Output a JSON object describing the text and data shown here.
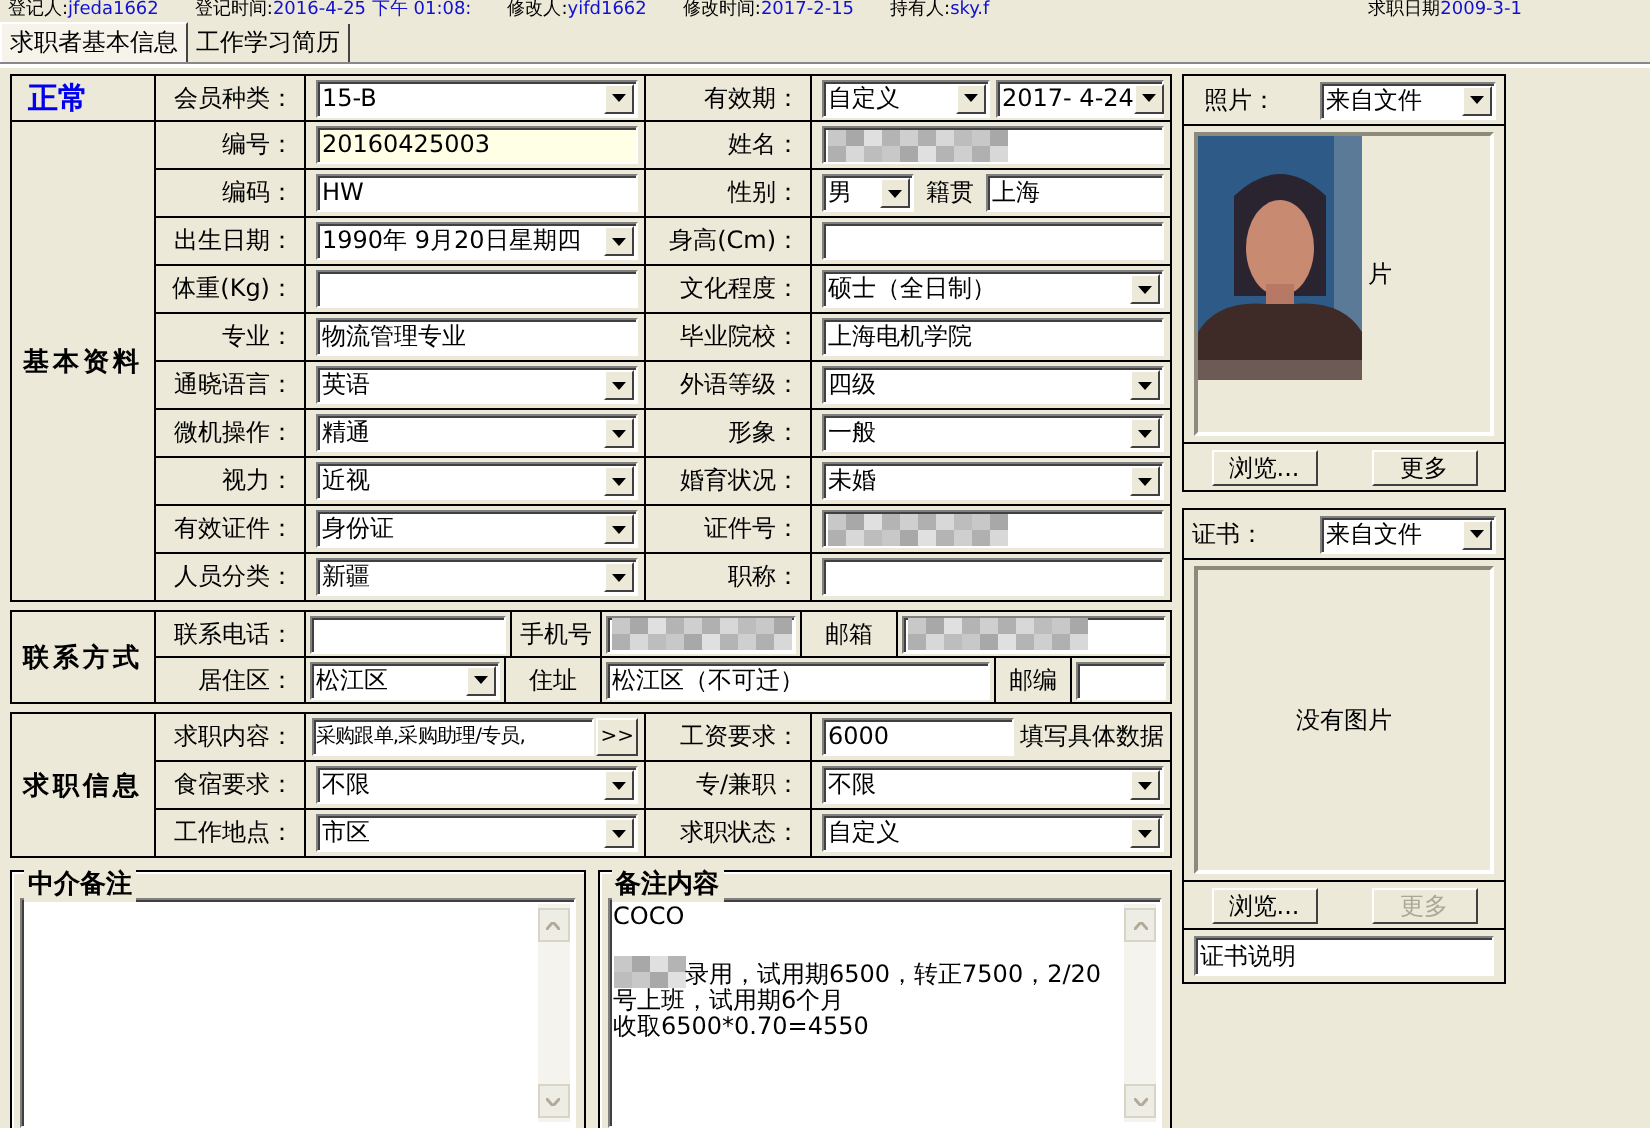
{
  "record_info": [
    {
      "label": "登记人:",
      "value": "jfeda1662"
    },
    {
      "label": "登记时间:",
      "value": "2016-4-25 下午 01:08:"
    },
    {
      "label": "修改人:",
      "value": "yifd1662"
    },
    {
      "label": "修改时间:",
      "value": "2017-2-15"
    },
    {
      "label": "持有人:",
      "value": "sky.f"
    },
    {
      "label": "求职日期",
      "value": "2009-3-1"
    }
  ],
  "tabs": [
    {
      "label": "求职者基本信息",
      "selected": true
    },
    {
      "label": "工作学习简历",
      "selected": false
    }
  ],
  "member_status": "正常",
  "header_row": {
    "left_label": "会员种类：",
    "left_fields": [
      {
        "kind": "select",
        "value": "15-B"
      }
    ],
    "right_label": "有效期：",
    "right_fields": [
      {
        "kind": "select",
        "value": "自定义"
      },
      {
        "kind": "select",
        "value": "2017- 4-24"
      }
    ]
  },
  "basic_info": {
    "title": "基本资料",
    "rows": [
      {
        "left_label": "编号：",
        "left_fields": [
          {
            "kind": "text",
            "value": "20160425003",
            "focused": true
          }
        ],
        "right_label": "姓名：",
        "right_fields": [
          {
            "kind": "redacted"
          }
        ]
      },
      {
        "left_label": "编码：",
        "left_fields": [
          {
            "kind": "text",
            "value": "HW"
          }
        ],
        "right_label": "性别：",
        "right_fields": [
          {
            "kind": "select",
            "value": "男"
          },
          {
            "kind": "label",
            "text": "籍贯"
          },
          {
            "kind": "text",
            "value": "上海"
          }
        ]
      },
      {
        "left_label": "出生日期：",
        "left_fields": [
          {
            "kind": "select",
            "value": "1990年 9月20日星期四"
          }
        ],
        "right_label": "身高(Cm)：",
        "right_fields": [
          {
            "kind": "text"
          }
        ]
      },
      {
        "left_label": "体重(Kg)：",
        "left_fields": [
          {
            "kind": "text"
          }
        ],
        "right_label": "文化程度：",
        "right_fields": [
          {
            "kind": "select",
            "value": "硕士（全日制）"
          }
        ]
      },
      {
        "left_label": "专业：",
        "left_fields": [
          {
            "kind": "text",
            "value": "物流管理专业"
          }
        ],
        "right_label": "毕业院校：",
        "right_fields": [
          {
            "kind": "text",
            "value": "上海电机学院"
          }
        ]
      },
      {
        "left_label": "通晓语言：",
        "left_fields": [
          {
            "kind": "select",
            "value": "英语"
          }
        ],
        "right_label": "外语等级：",
        "right_fields": [
          {
            "kind": "select",
            "value": "四级"
          }
        ]
      },
      {
        "left_label": "微机操作：",
        "left_fields": [
          {
            "kind": "select",
            "value": "精通"
          }
        ],
        "right_label": "形象：",
        "right_fields": [
          {
            "kind": "select",
            "value": "一般"
          }
        ]
      },
      {
        "left_label": "视力：",
        "left_fields": [
          {
            "kind": "select",
            "value": "近视"
          }
        ],
        "right_label": "婚育状况：",
        "right_fields": [
          {
            "kind": "select",
            "value": "未婚"
          }
        ]
      },
      {
        "left_label": "有效证件：",
        "left_fields": [
          {
            "kind": "select",
            "value": "身份证"
          }
        ],
        "right_label": "证件号：",
        "right_fields": [
          {
            "kind": "redacted"
          }
        ]
      },
      {
        "left_label": "人员分类：",
        "left_fields": [
          {
            "kind": "select",
            "value": "新疆"
          }
        ],
        "right_label": "职称：",
        "right_fields": [
          {
            "kind": "text"
          }
        ]
      }
    ]
  },
  "contact": {
    "title": "联系方式",
    "rows": [
      {
        "label": "联系电话：",
        "fields": [
          {
            "kind": "text"
          },
          {
            "kind": "label",
            "text": "手机号"
          },
          {
            "kind": "redacted"
          },
          {
            "kind": "label",
            "text": "邮箱"
          },
          {
            "kind": "redacted"
          }
        ]
      },
      {
        "label": "居住区：",
        "fields": [
          {
            "kind": "select",
            "value": "松江区"
          },
          {
            "kind": "label",
            "text": "住址"
          },
          {
            "kind": "text",
            "value": "松江区（不可迁）"
          },
          {
            "kind": "label",
            "text": "邮编"
          },
          {
            "kind": "text"
          }
        ]
      }
    ]
  },
  "job": {
    "title": "求职信息",
    "rows": [
      {
        "left_label": "求职内容：",
        "left_fields": [
          {
            "kind": "text",
            "value": "采购跟单,采购助理/专员,"
          },
          {
            "kind": "more_button",
            "label": ">>"
          }
        ],
        "right_label": "工资要求：",
        "right_fields": [
          {
            "kind": "text",
            "value": "6000"
          },
          {
            "kind": "note",
            "text": "填写具体数据"
          }
        ]
      },
      {
        "left_label": "食宿要求：",
        "left_fields": [
          {
            "kind": "select",
            "value": "不限"
          }
        ],
        "right_label": "专/兼职：",
        "right_fields": [
          {
            "kind": "select",
            "value": "不限"
          }
        ]
      },
      {
        "left_label": "工作地点：",
        "left_fields": [
          {
            "kind": "select",
            "value": "市区"
          }
        ],
        "right_label": "求职状态：",
        "right_fields": [
          {
            "kind": "select",
            "value": "自定义"
          }
        ]
      }
    ]
  },
  "notes": [
    {
      "title": "中介备注"
    },
    {
      "title": "备注内容",
      "paragraphs": [
        {
          "kind": "plain",
          "text": "COCO"
        },
        {
          "kind": "redacted_start",
          "text": "录用，试用期6500，转正7500，2/20号上班，试用期6个月"
        },
        {
          "kind": "plain",
          "text": "收取6500*0.70=4550"
        }
      ]
    }
  ],
  "photo": {
    "label": "照片：",
    "source": "来自文件",
    "caption": "片",
    "buttons": [
      {
        "label": "浏览...",
        "disabled": false
      },
      {
        "label": "更多",
        "disabled": false
      }
    ]
  },
  "certificate": {
    "label": "证书：",
    "source": "来自文件",
    "empty_text": "没有图片",
    "buttons": [
      {
        "label": "浏览...",
        "disabled": false
      },
      {
        "label": "更多",
        "disabled": true
      }
    ],
    "description": "证书说明"
  }
}
